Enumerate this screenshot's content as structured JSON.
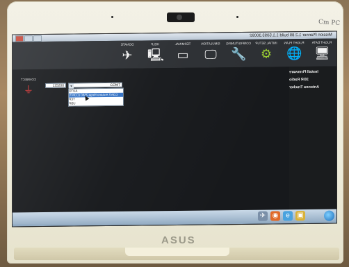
{
  "sticker": {
    "text": "Cm PC"
  },
  "laptop": {
    "brand": "ASUS"
  },
  "window": {
    "title": "Mission Planner 1.2.89 build 1.1.5093.30092"
  },
  "menu": {
    "items": [
      {
        "label": "FLIGHT DATA",
        "icon": "monitor-icon"
      },
      {
        "label": "FLIGHT PLAN",
        "icon": "globe-icon"
      },
      {
        "label": "INITIAL SETUP",
        "icon": "gear-plus-icon"
      },
      {
        "label": "CONFIG/TUNING",
        "icon": "wrench-icon"
      },
      {
        "label": "SIMULATION",
        "icon": "monitor-arrow-icon"
      },
      {
        "label": "TERMINAL",
        "icon": "terminal-icon"
      },
      {
        "label": "HELP",
        "icon": "monitor-question-icon"
      },
      {
        "label": "DONATE",
        "icon": "plane-icon"
      }
    ]
  },
  "sidebar": {
    "items": [
      "Install Firmware",
      "3DR Radio",
      "Antenna Tracker"
    ]
  },
  "connection": {
    "connect_label": "CONNECT",
    "baud": "115200",
    "port": "COM7",
    "options": [
      "AUTO",
      "COM7 Arduino Mega 2560 (COM7)",
      "TCP",
      "UDP"
    ],
    "selected_index": 1
  },
  "colors": {
    "menubar": "#2c2f33",
    "content": "#17191c",
    "accent": "#9acd32",
    "selection": "#3170c4"
  }
}
